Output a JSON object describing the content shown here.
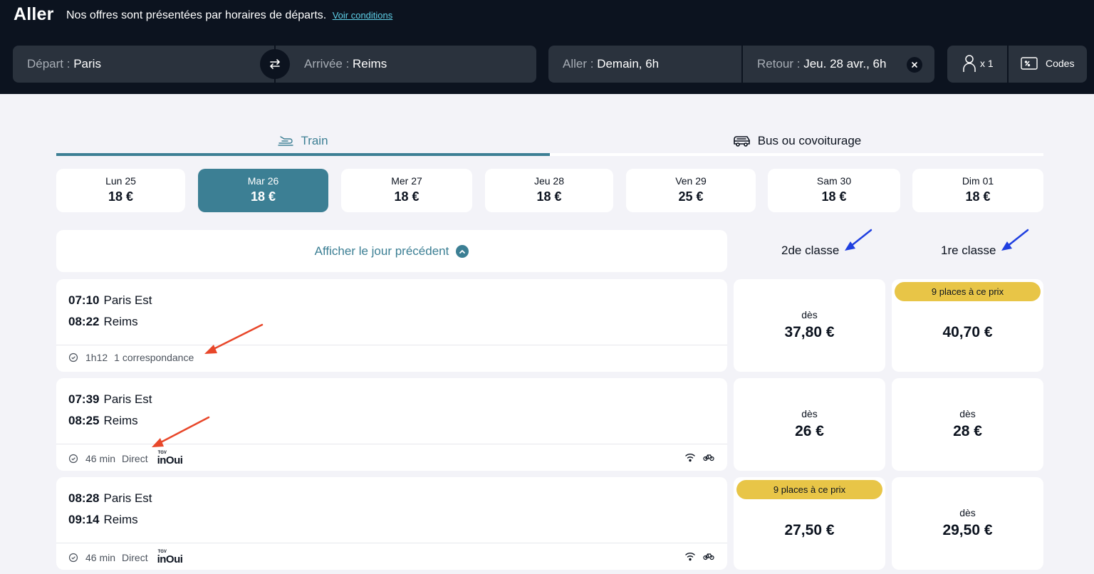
{
  "header": {
    "title": "Aller",
    "subtitle": "Nos offres sont présentées par horaires de départs.",
    "conditions_link": "Voir conditions"
  },
  "search": {
    "departure_label": "Départ :",
    "departure_value": "Paris",
    "arrival_label": "Arrivée :",
    "arrival_value": "Reims",
    "outbound_label": "Aller :",
    "outbound_value": "Demain, 6h",
    "return_label": "Retour :",
    "return_value": "Jeu. 28 avr., 6h",
    "passengers": "x 1",
    "codes_label": "Codes"
  },
  "tabs": {
    "train": "Train",
    "bus": "Bus ou covoiturage"
  },
  "dates": [
    {
      "day": "Lun 25",
      "price": "18 €"
    },
    {
      "day": "Mar 26",
      "price": "18 €"
    },
    {
      "day": "Mer 27",
      "price": "18 €"
    },
    {
      "day": "Jeu 28",
      "price": "18 €"
    },
    {
      "day": "Ven 29",
      "price": "25 €"
    },
    {
      "day": "Sam 30",
      "price": "18 €"
    },
    {
      "day": "Dim 01",
      "price": "18 €"
    }
  ],
  "selected_date_index": 1,
  "prev_day_label": "Afficher le jour précédent",
  "class_headers": {
    "second": "2de classe",
    "first": "1re classe"
  },
  "journeys": [
    {
      "dep_time": "07:10",
      "dep_station": "Paris Est",
      "arr_time": "08:22",
      "arr_station": "Reims",
      "duration": "1h12",
      "connection": "1 correspondance",
      "second": {
        "from": "dès",
        "price": "37,80 €",
        "badge": ""
      },
      "first": {
        "from": "",
        "price": "40,70 €",
        "badge": "9 places à ce prix"
      }
    },
    {
      "dep_time": "07:39",
      "dep_station": "Paris Est",
      "arr_time": "08:25",
      "arr_station": "Reims",
      "duration": "46 min",
      "connection": "Direct",
      "brand_small": "TGV",
      "brand": "inOui",
      "second": {
        "from": "dès",
        "price": "26 €",
        "badge": ""
      },
      "first": {
        "from": "dès",
        "price": "28 €",
        "badge": ""
      }
    },
    {
      "dep_time": "08:28",
      "dep_station": "Paris Est",
      "arr_time": "09:14",
      "arr_station": "Reims",
      "duration": "46 min",
      "connection": "Direct",
      "brand_small": "TGV",
      "brand": "inOui",
      "second": {
        "from": "",
        "price": "27,50 €",
        "badge": "9 places à ce prix"
      },
      "first": {
        "from": "dès",
        "price": "29,50 €",
        "badge": ""
      }
    }
  ],
  "colors": {
    "header_bg": "#0c131f",
    "accent": "#3c7f94",
    "badge": "#e8c547",
    "annotation_red": "#e8472a",
    "annotation_blue": "#1f3fe0"
  }
}
